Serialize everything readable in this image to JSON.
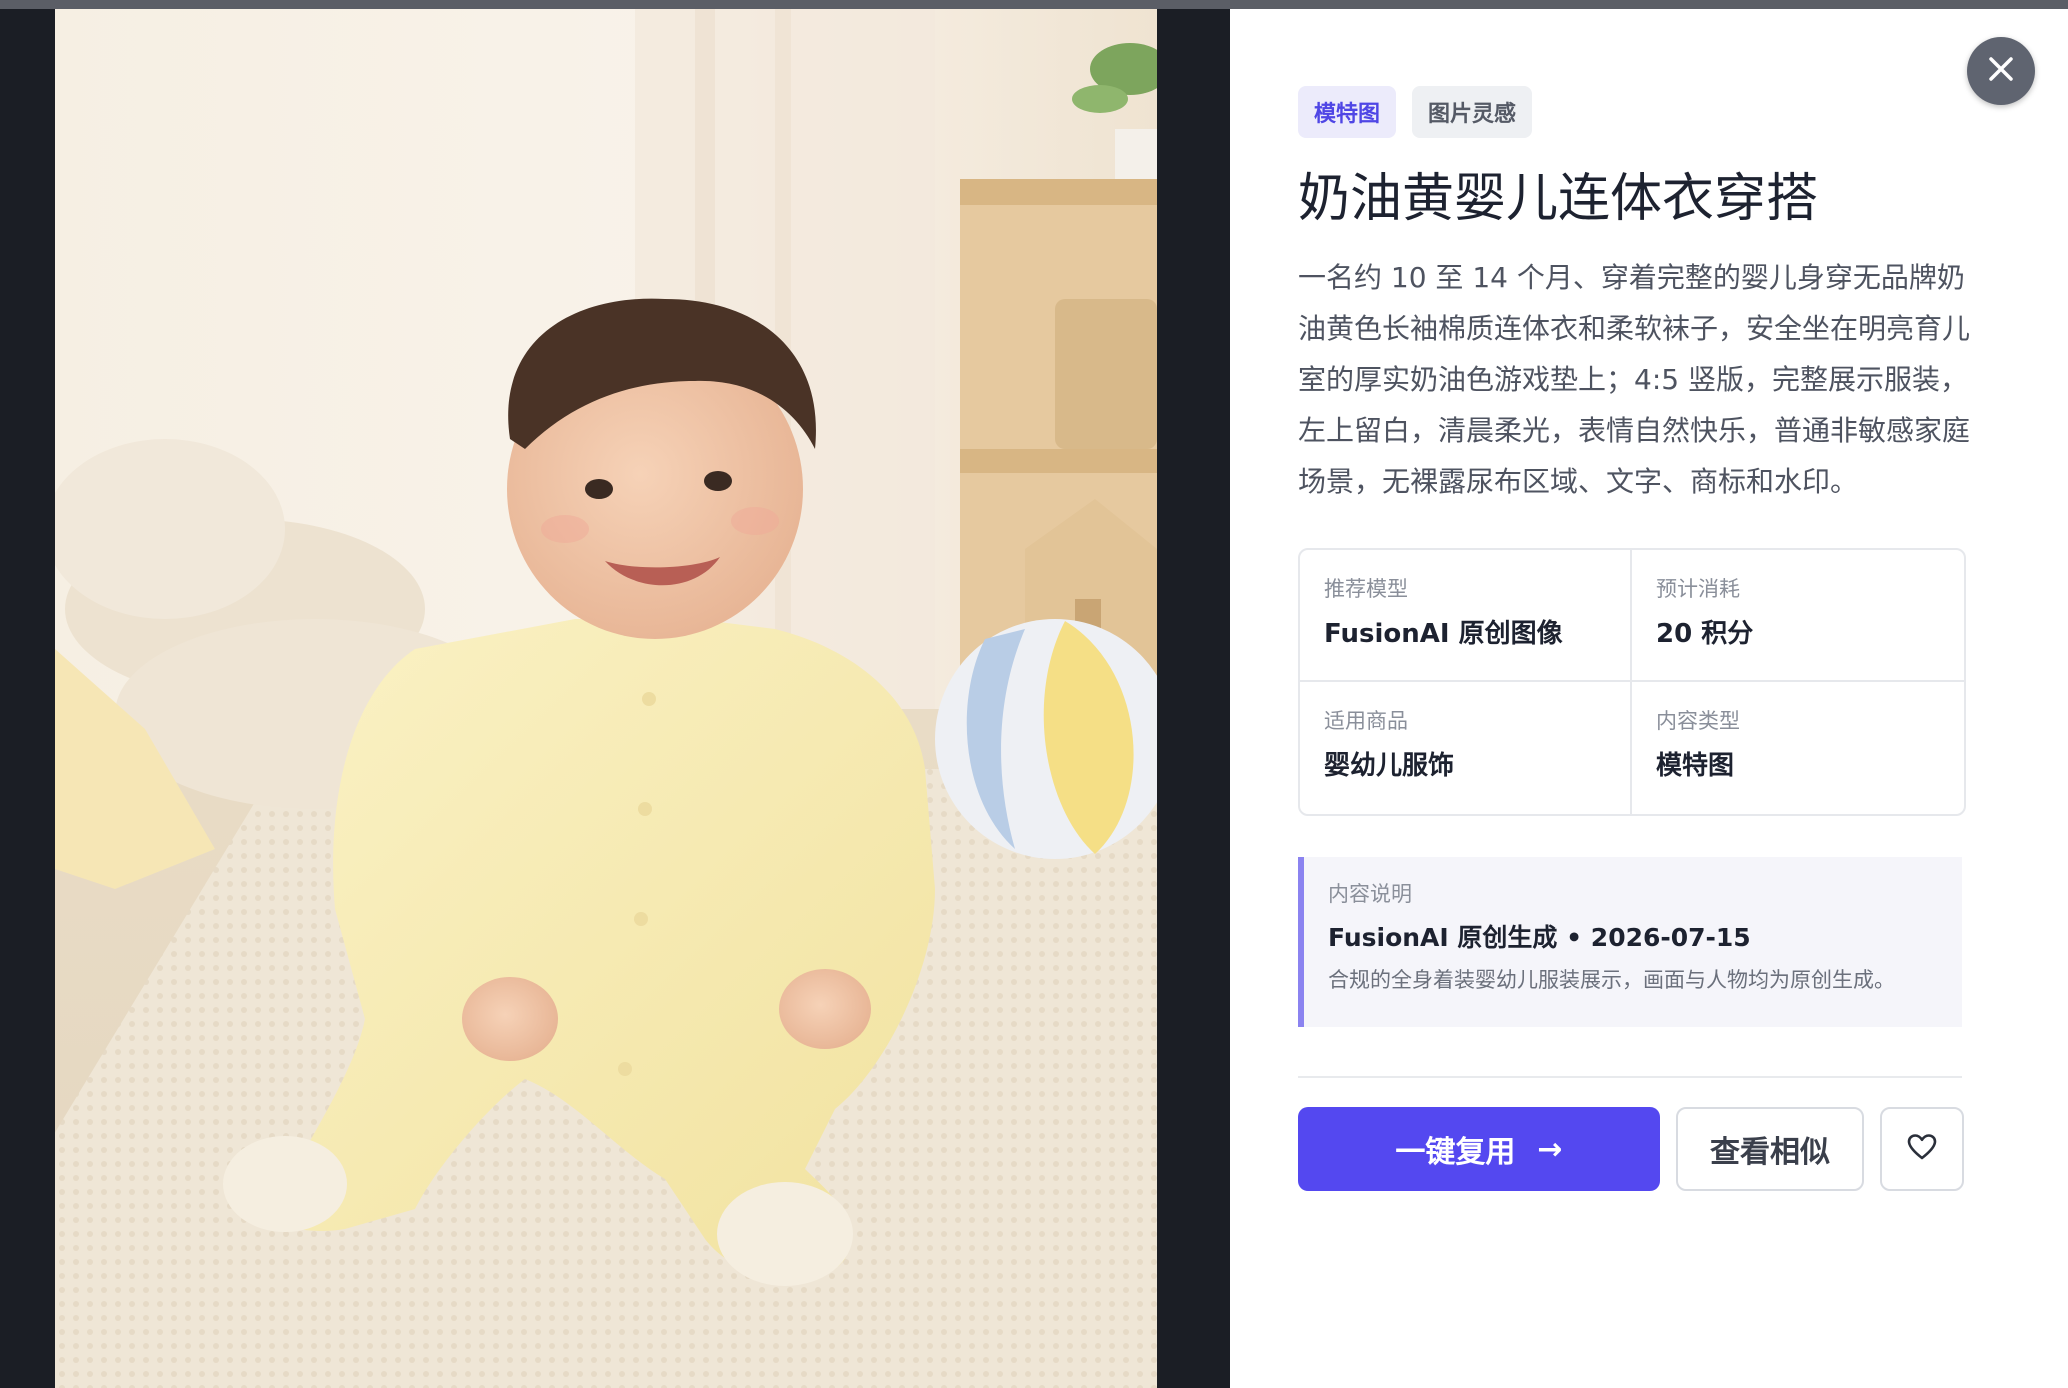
{
  "tags": [
    "模特图",
    "图片灵感"
  ],
  "title": "奶油黄婴儿连体衣穿搭",
  "description": "一名约 10 至 14 个月、穿着完整的婴儿身穿无品牌奶油黄色长袖棉质连体衣和柔软袜子，安全坐在明亮育儿室的厚实奶油色游戏垫上；4:5 竖版，完整展示服装，左上留白，清晨柔光，表情自然快乐，普通非敏感家庭场景，无裸露尿布区域、文字、商标和水印。",
  "attributes": [
    {
      "label": "推荐模型",
      "value": "FusionAI 原创图像"
    },
    {
      "label": "预计消耗",
      "value": "20 积分"
    },
    {
      "label": "适用商品",
      "value": "婴幼儿服饰"
    },
    {
      "label": "内容类型",
      "value": "模特图"
    }
  ],
  "note": {
    "label": "内容说明",
    "title": "FusionAI 原创生成 • 2026-07-15",
    "text": "合规的全身着装婴幼儿服装展示，画面与人物均为原创生成。"
  },
  "actions": {
    "reuse_label": "一键复用",
    "reuse_arrow": "→",
    "similar_label": "查看相似"
  },
  "icons": {
    "close": "close-icon",
    "favorite": "heart-icon",
    "arrow": "arrow-right-icon"
  },
  "colors": {
    "accent": "#5448f0",
    "tag_primary_text": "#4f46e5",
    "note_border": "#8b83f0"
  }
}
